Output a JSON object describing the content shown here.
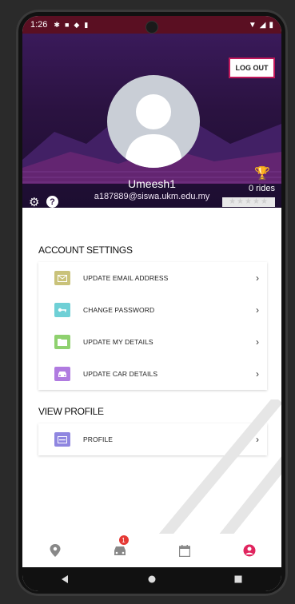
{
  "status_bar": {
    "time": "1:26"
  },
  "header": {
    "logout_label": "LOG OUT",
    "username": "Umeesh1",
    "email": "a187889@siswa.ukm.edu.my",
    "rides": "0 rides",
    "rating_stars": "★★★★★"
  },
  "account_settings": {
    "title": "ACCOUNT SETTINGS",
    "items": [
      {
        "label": "UPDATE EMAIL ADDRESS",
        "icon": "email-icon",
        "color": "#c9c27a"
      },
      {
        "label": "CHANGE PASSWORD",
        "icon": "key-icon",
        "color": "#6fd0d6"
      },
      {
        "label": "UPDATE MY DETAILS",
        "icon": "folder-icon",
        "color": "#8fd16f"
      },
      {
        "label": "UPDATE CAR DETAILS",
        "icon": "car-icon",
        "color": "#b07be0"
      }
    ]
  },
  "view_profile": {
    "title": "VIEW PROFILE",
    "items": [
      {
        "label": "PROFILE",
        "icon": "profile-card-icon",
        "color": "#8f86e0"
      }
    ]
  },
  "bottom_nav": {
    "badge_count": "1",
    "active_color": "#e0245e",
    "items": [
      "location-icon",
      "car-icon",
      "calendar-icon",
      "user-icon"
    ]
  },
  "colors": {
    "accent": "#c2185b",
    "header_dark": "#2a1240"
  }
}
